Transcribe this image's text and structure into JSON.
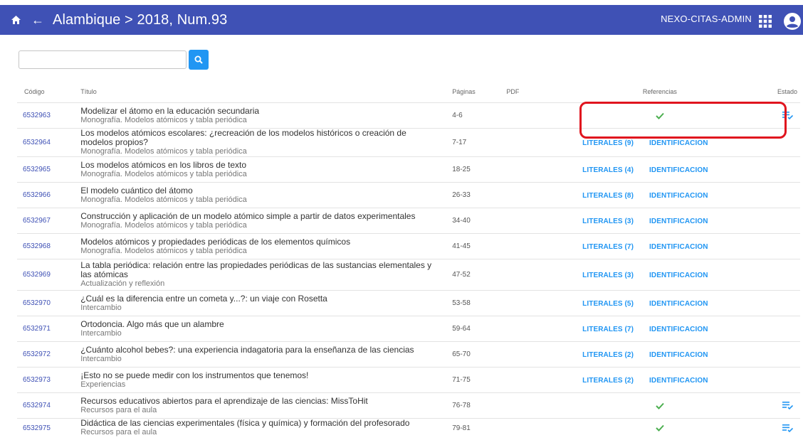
{
  "appbar": {
    "title": "Alambique > 2018, Num.93",
    "user": "NEXO-CITAS-ADMIN"
  },
  "search": {
    "placeholder": ""
  },
  "colors": {
    "appbar": "#3f51b5",
    "link": "#2196f3",
    "check": "#4caf50",
    "highlight": "#e0141e"
  },
  "table": {
    "headers": {
      "code": "Código",
      "title": "Título",
      "pages": "Páginas",
      "pdf": "PDF",
      "refs": "Referencias",
      "estado": "Estado"
    },
    "rows": [
      {
        "code": "6532963",
        "title": "Modelizar el átomo en la educación secundaria",
        "title2": "",
        "section": "Monografía. Modelos atómicos y tabla periódica",
        "pages": "4-6",
        "refs": "check",
        "estado": "done"
      },
      {
        "code": "6532964",
        "title": "Los modelos atómicos escolares: ¿recreación de los modelos históricos o creación de",
        "title2": "modelos propios?",
        "section": "Monografía. Modelos atómicos y tabla periódica",
        "pages": "7-17",
        "refs": "links",
        "literales": "LITERALES (9)",
        "ident": "IDENTIFICACION"
      },
      {
        "code": "6532965",
        "title": "Los modelos atómicos en los libros de texto",
        "title2": "",
        "section": "Monografía. Modelos atómicos y tabla periódica",
        "pages": "18-25",
        "refs": "links",
        "literales": "LITERALES (4)",
        "ident": "IDENTIFICACION"
      },
      {
        "code": "6532966",
        "title": "El modelo cuántico del átomo",
        "title2": "",
        "section": "Monografía. Modelos atómicos y tabla periódica",
        "pages": "26-33",
        "refs": "links",
        "literales": "LITERALES (8)",
        "ident": "IDENTIFICACION"
      },
      {
        "code": "6532967",
        "title": "Construcción y aplicación de un modelo atómico simple a partir de datos experimentales",
        "title2": "",
        "section": "Monografía. Modelos atómicos y tabla periódica",
        "pages": "34-40",
        "refs": "links",
        "literales": "LITERALES (3)",
        "ident": "IDENTIFICACION"
      },
      {
        "code": "6532968",
        "title": "Modelos atómicos y propiedades periódicas de los elementos químicos",
        "title2": "",
        "section": "Monografía. Modelos atómicos y tabla periódica",
        "pages": "41-45",
        "refs": "links",
        "literales": "LITERALES (7)",
        "ident": "IDENTIFICACION"
      },
      {
        "code": "6532969",
        "title": "La tabla periódica: relación entre las propiedades periódicas de las sustancias elementales y",
        "title2": "las atómicas",
        "section": "Actualización y reflexión",
        "pages": "47-52",
        "refs": "links",
        "literales": "LITERALES (3)",
        "ident": "IDENTIFICACION"
      },
      {
        "code": "6532970",
        "title": "¿Cuál es la diferencia entre un cometa y...?: un viaje con Rosetta",
        "title2": "",
        "section": "Intercambio",
        "pages": "53-58",
        "refs": "links",
        "literales": "LITERALES (5)",
        "ident": "IDENTIFICACION"
      },
      {
        "code": "6532971",
        "title": "Ortodoncia. Algo más que un alambre",
        "title2": "",
        "section": "Intercambio",
        "pages": "59-64",
        "refs": "links",
        "literales": "LITERALES (7)",
        "ident": "IDENTIFICACION"
      },
      {
        "code": "6532972",
        "title": "¿Cuánto alcohol bebes?: una experiencia indagatoria para la enseñanza de las ciencias",
        "title2": "",
        "section": "Intercambio",
        "pages": "65-70",
        "refs": "links",
        "literales": "LITERALES (2)",
        "ident": "IDENTIFICACION"
      },
      {
        "code": "6532973",
        "title": "¡Esto no se puede medir con los instrumentos que tenemos!",
        "title2": "",
        "section": "Experiencias",
        "pages": "71-75",
        "refs": "links",
        "literales": "LITERALES (2)",
        "ident": "IDENTIFICACION"
      },
      {
        "code": "6532974",
        "title": "Recursos educativos abiertos para el aprendizaje de las ciencias: MissToHit",
        "title2": "",
        "section": "Recursos para el aula",
        "pages": "76-78",
        "refs": "check",
        "estado": "done"
      },
      {
        "code": "6532975",
        "title": "Didáctica de las ciencias experimentales (física y química) y formación del profesorado",
        "title2": "",
        "section": "Recursos para el aula",
        "pages": "79-81",
        "refs": "check",
        "estado": "done"
      }
    ]
  }
}
